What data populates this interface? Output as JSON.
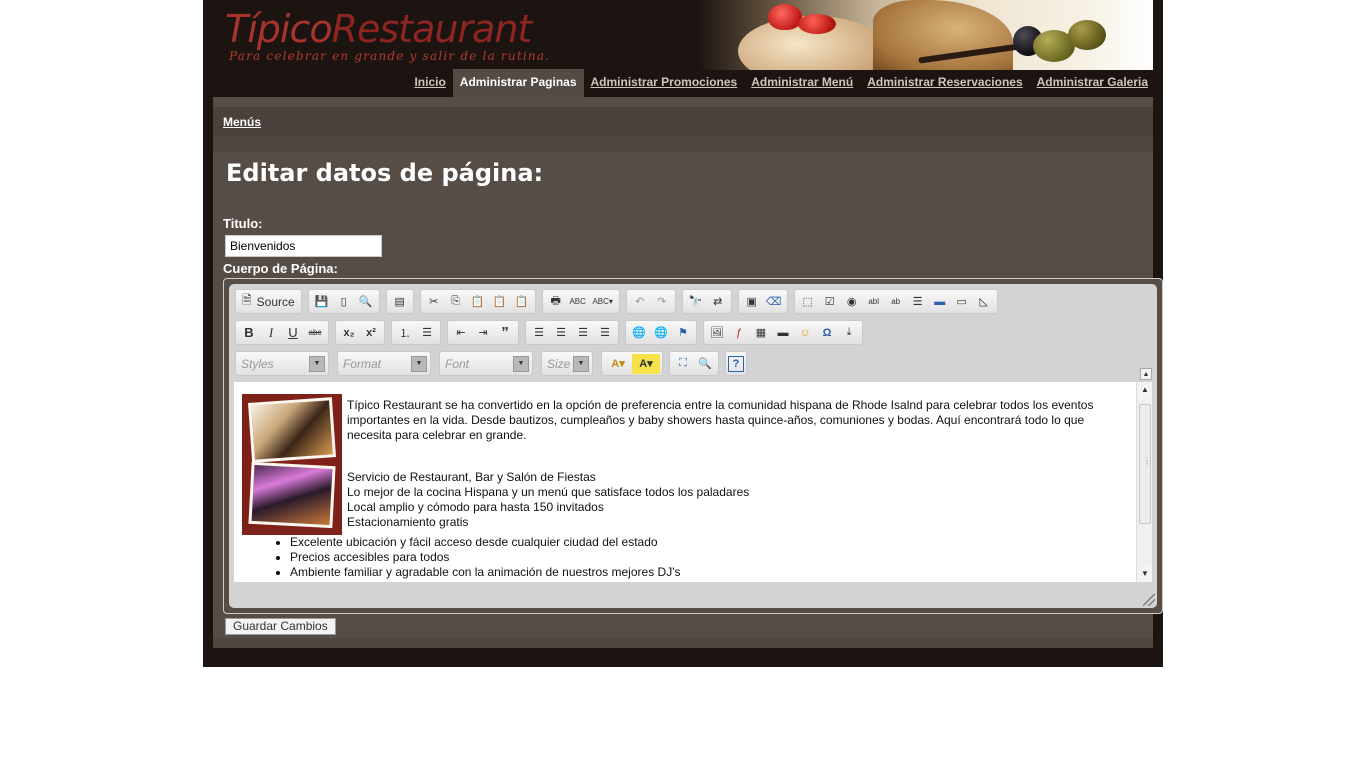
{
  "header": {
    "logo_part1": "Típico",
    "logo_part2": "Restaurant",
    "tagline": "Para celebrar en grande y salir de la rutina."
  },
  "nav": {
    "items": [
      {
        "label": "Inicio",
        "active": false
      },
      {
        "label": "Administrar Paginas",
        "active": true
      },
      {
        "label": "Administrar Promociones",
        "active": false
      },
      {
        "label": "Administrar Menú",
        "active": false
      },
      {
        "label": "Administrar Reservaciones",
        "active": false
      },
      {
        "label": "Administrar Galeria",
        "active": false
      }
    ]
  },
  "subnav": {
    "link": "Menús"
  },
  "page": {
    "title": "Editar datos de página:",
    "titulo_label": "Titulo:",
    "titulo_value": "Bienvenidos",
    "cuerpo_label": "Cuerpo de Página:"
  },
  "editor": {
    "source_label": "Source",
    "combos": {
      "styles": "Styles",
      "format": "Format",
      "font": "Font",
      "size": "Size"
    },
    "content": {
      "intro": "Típico Restaurant se ha convertido en la opción de preferencia entre la comunidad hispana de Rhode Isalnd para celebrar todos los eventos importantes en la vida. Desde bautizos, cumpleaños y baby showers hasta quince-años, comuniones y bodas. Aquí encontrará todo lo que necesita para celebrar en grande.",
      "bullets_inline": [
        "Servicio de Restaurant, Bar y Salón de Fiestas",
        "Lo mejor de la cocina Hispana y un menú que satisface todos los paladares",
        "Local amplio y cómodo para hasta 150 invitados",
        "Estacionamiento gratis"
      ],
      "bullets": [
        "Excelente ubicación y fácil acceso desde cualquier ciudad del estado",
        "Precios accesibles para todos",
        "Ambiente familiar y agradable con la animación de nuestros mejores DJ's"
      ]
    }
  },
  "actions": {
    "save": "Guardar Cambios"
  },
  "colors": {
    "page_bg": "#1b1411",
    "content_bg": "#574d47",
    "logo": "#a6332d"
  }
}
